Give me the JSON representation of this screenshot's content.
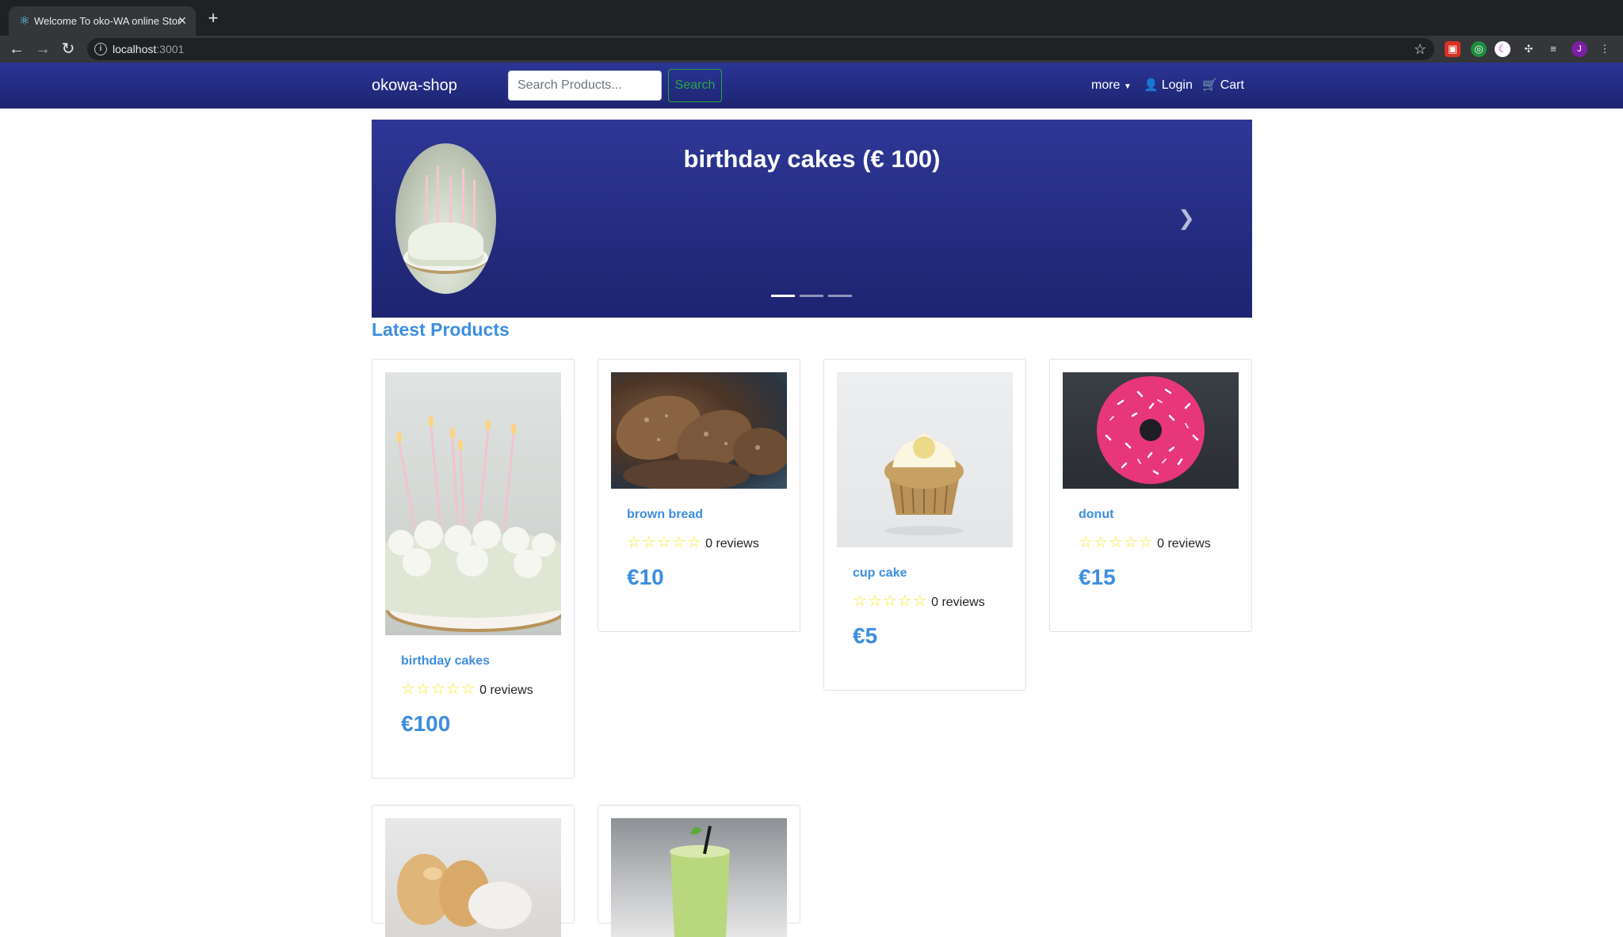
{
  "browser": {
    "tab_title": "Welcome To oko-WA online Store",
    "url_host": "localhost",
    "url_port": ":3001",
    "profile_initial": "J"
  },
  "nav": {
    "brand": "okowa-shop",
    "search_placeholder": "Search Products...",
    "search_button": "Search",
    "more_label": "more",
    "login_label": "Login",
    "cart_label": "Cart"
  },
  "hero": {
    "title": "birthday cakes (€ 100)",
    "slides": 3,
    "active_slide": 0
  },
  "section_title": "Latest Products",
  "products": [
    {
      "name": "birthday cakes",
      "reviews": "0 reviews",
      "price": "€100"
    },
    {
      "name": "brown bread",
      "reviews": "0 reviews",
      "price": "€10"
    },
    {
      "name": "cup cake",
      "reviews": "0 reviews",
      "price": "€5"
    },
    {
      "name": "donut",
      "reviews": "0 reviews",
      "price": "€15"
    }
  ],
  "colors": {
    "navbar": "#1d2470",
    "accent": "#3d8ee0",
    "star": "#f8e825",
    "search_button": "#28a745"
  }
}
